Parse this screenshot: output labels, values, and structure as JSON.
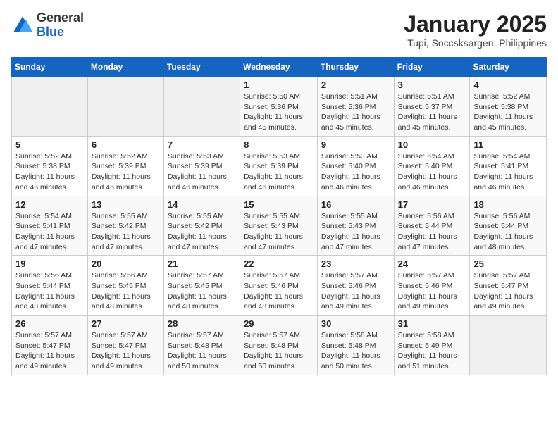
{
  "header": {
    "logo": {
      "general": "General",
      "blue": "Blue"
    },
    "title": "January 2025",
    "subtitle": "Tupi, Soccsksargen, Philippines"
  },
  "weekdays": [
    "Sunday",
    "Monday",
    "Tuesday",
    "Wednesday",
    "Thursday",
    "Friday",
    "Saturday"
  ],
  "weeks": [
    [
      {
        "day": "",
        "info": ""
      },
      {
        "day": "",
        "info": ""
      },
      {
        "day": "",
        "info": ""
      },
      {
        "day": "1",
        "info": "Sunrise: 5:50 AM\nSunset: 5:36 PM\nDaylight: 11 hours and 45 minutes."
      },
      {
        "day": "2",
        "info": "Sunrise: 5:51 AM\nSunset: 5:36 PM\nDaylight: 11 hours and 45 minutes."
      },
      {
        "day": "3",
        "info": "Sunrise: 5:51 AM\nSunset: 5:37 PM\nDaylight: 11 hours and 45 minutes."
      },
      {
        "day": "4",
        "info": "Sunrise: 5:52 AM\nSunset: 5:38 PM\nDaylight: 11 hours and 45 minutes."
      }
    ],
    [
      {
        "day": "5",
        "info": "Sunrise: 5:52 AM\nSunset: 5:38 PM\nDaylight: 11 hours and 46 minutes."
      },
      {
        "day": "6",
        "info": "Sunrise: 5:52 AM\nSunset: 5:39 PM\nDaylight: 11 hours and 46 minutes."
      },
      {
        "day": "7",
        "info": "Sunrise: 5:53 AM\nSunset: 5:39 PM\nDaylight: 11 hours and 46 minutes."
      },
      {
        "day": "8",
        "info": "Sunrise: 5:53 AM\nSunset: 5:39 PM\nDaylight: 11 hours and 46 minutes."
      },
      {
        "day": "9",
        "info": "Sunrise: 5:53 AM\nSunset: 5:40 PM\nDaylight: 11 hours and 46 minutes."
      },
      {
        "day": "10",
        "info": "Sunrise: 5:54 AM\nSunset: 5:40 PM\nDaylight: 11 hours and 46 minutes."
      },
      {
        "day": "11",
        "info": "Sunrise: 5:54 AM\nSunset: 5:41 PM\nDaylight: 11 hours and 46 minutes."
      }
    ],
    [
      {
        "day": "12",
        "info": "Sunrise: 5:54 AM\nSunset: 5:41 PM\nDaylight: 11 hours and 47 minutes."
      },
      {
        "day": "13",
        "info": "Sunrise: 5:55 AM\nSunset: 5:42 PM\nDaylight: 11 hours and 47 minutes."
      },
      {
        "day": "14",
        "info": "Sunrise: 5:55 AM\nSunset: 5:42 PM\nDaylight: 11 hours and 47 minutes."
      },
      {
        "day": "15",
        "info": "Sunrise: 5:55 AM\nSunset: 5:43 PM\nDaylight: 11 hours and 47 minutes."
      },
      {
        "day": "16",
        "info": "Sunrise: 5:55 AM\nSunset: 5:43 PM\nDaylight: 11 hours and 47 minutes."
      },
      {
        "day": "17",
        "info": "Sunrise: 5:56 AM\nSunset: 5:44 PM\nDaylight: 11 hours and 47 minutes."
      },
      {
        "day": "18",
        "info": "Sunrise: 5:56 AM\nSunset: 5:44 PM\nDaylight: 11 hours and 48 minutes."
      }
    ],
    [
      {
        "day": "19",
        "info": "Sunrise: 5:56 AM\nSunset: 5:44 PM\nDaylight: 11 hours and 48 minutes."
      },
      {
        "day": "20",
        "info": "Sunrise: 5:56 AM\nSunset: 5:45 PM\nDaylight: 11 hours and 48 minutes."
      },
      {
        "day": "21",
        "info": "Sunrise: 5:57 AM\nSunset: 5:45 PM\nDaylight: 11 hours and 48 minutes."
      },
      {
        "day": "22",
        "info": "Sunrise: 5:57 AM\nSunset: 5:46 PM\nDaylight: 11 hours and 48 minutes."
      },
      {
        "day": "23",
        "info": "Sunrise: 5:57 AM\nSunset: 5:46 PM\nDaylight: 11 hours and 49 minutes."
      },
      {
        "day": "24",
        "info": "Sunrise: 5:57 AM\nSunset: 5:46 PM\nDaylight: 11 hours and 49 minutes."
      },
      {
        "day": "25",
        "info": "Sunrise: 5:57 AM\nSunset: 5:47 PM\nDaylight: 11 hours and 49 minutes."
      }
    ],
    [
      {
        "day": "26",
        "info": "Sunrise: 5:57 AM\nSunset: 5:47 PM\nDaylight: 11 hours and 49 minutes."
      },
      {
        "day": "27",
        "info": "Sunrise: 5:57 AM\nSunset: 5:47 PM\nDaylight: 11 hours and 49 minutes."
      },
      {
        "day": "28",
        "info": "Sunrise: 5:57 AM\nSunset: 5:48 PM\nDaylight: 11 hours and 50 minutes."
      },
      {
        "day": "29",
        "info": "Sunrise: 5:57 AM\nSunset: 5:48 PM\nDaylight: 11 hours and 50 minutes."
      },
      {
        "day": "30",
        "info": "Sunrise: 5:58 AM\nSunset: 5:48 PM\nDaylight: 11 hours and 50 minutes."
      },
      {
        "day": "31",
        "info": "Sunrise: 5:58 AM\nSunset: 5:49 PM\nDaylight: 11 hours and 51 minutes."
      },
      {
        "day": "",
        "info": ""
      }
    ]
  ]
}
